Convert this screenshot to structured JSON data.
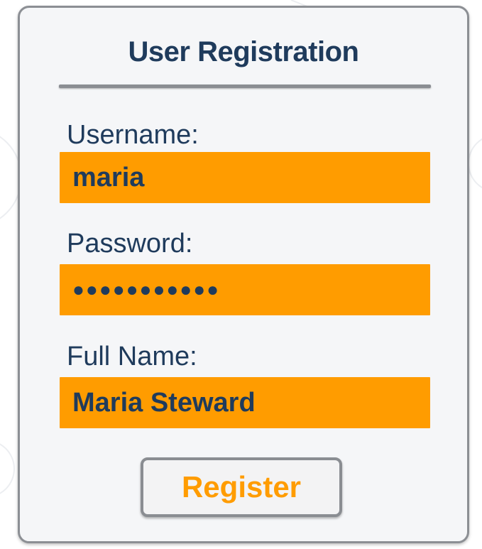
{
  "form": {
    "title": "User Registration",
    "fields": [
      {
        "label": "Username:",
        "value": "maria"
      },
      {
        "label": "Password:",
        "value": "●●●●●●●●●●●"
      },
      {
        "label": "Full Name:",
        "value": "Maria Steward"
      }
    ],
    "submit_label": "Register"
  },
  "colors": {
    "input_background": "#ff9c00",
    "text": "#1f3b5c",
    "button_text": "#ff9c00",
    "card_background": "#f5f6f8",
    "card_border": "#8c8f94"
  }
}
